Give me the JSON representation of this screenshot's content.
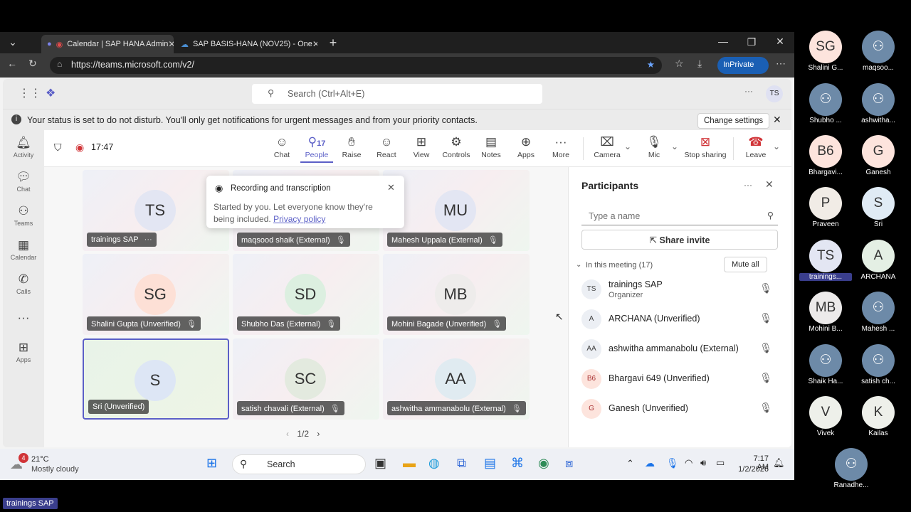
{
  "browser": {
    "tabs": [
      {
        "label": "Calendar | SAP HANA Admin"
      },
      {
        "label": "SAP BASIS-HANA (NOV25) - One"
      }
    ],
    "url": "https://teams.microsoft.com/v2/",
    "inprivate": "InPrivate"
  },
  "teams": {
    "search_placeholder": "Search (Ctrl+Alt+E)",
    "user_initials": "TS",
    "notice": "Your status is set to do not disturb. You'll only get notifications for urgent messages and from your priority contacts.",
    "change_settings": "Change settings",
    "rail": [
      {
        "label": "Activity",
        "icon": "bell-icon"
      },
      {
        "label": "Chat",
        "icon": "chat-icon"
      },
      {
        "label": "Teams",
        "icon": "teams-icon"
      },
      {
        "label": "Calendar",
        "icon": "calendar-icon"
      },
      {
        "label": "Calls",
        "icon": "phone-icon"
      },
      {
        "label": "Apps",
        "icon": "apps-icon"
      }
    ]
  },
  "meeting": {
    "timer": "17:47",
    "controls": {
      "chat": "Chat",
      "people": "People",
      "people_count": "17",
      "raise": "Raise",
      "react": "React",
      "view": "View",
      "controls": "Controls",
      "notes": "Notes",
      "apps": "Apps",
      "more": "More",
      "camera": "Camera",
      "mic": "Mic",
      "stop_sharing": "Stop sharing",
      "leave": "Leave"
    },
    "popup": {
      "title": "Recording and transcription",
      "body": "Started by you. Let everyone know they're being included.",
      "link": "Privacy policy"
    },
    "tiles": [
      {
        "initials": "TS",
        "name": "trainings SAP",
        "more": "···"
      },
      {
        "initials": "",
        "name": "maqsood shaik (External)"
      },
      {
        "initials": "MU",
        "name": "Mahesh Uppala (External)"
      },
      {
        "initials": "SG",
        "name": "Shalini Gupta (Unverified)"
      },
      {
        "initials": "SD",
        "name": "Shubho Das (External)"
      },
      {
        "initials": "MB",
        "name": "Mohini Bagade (Unverified)"
      },
      {
        "initials": "S",
        "name": "Sri (Unverified)"
      },
      {
        "initials": "SC",
        "name": "satish chavali (External)"
      },
      {
        "initials": "AA",
        "name": "ashwitha ammanabolu (External)"
      }
    ],
    "pagination": "1/2"
  },
  "participants": {
    "title": "Participants",
    "search_placeholder": "Type a name",
    "share_invite": "Share invite",
    "section": "In this meeting (17)",
    "mute_all": "Mute all",
    "list": [
      {
        "initials": "TS",
        "name": "trainings SAP",
        "role": "Organizer"
      },
      {
        "initials": "A",
        "name": "ARCHANA (Unverified)"
      },
      {
        "initials": "AA",
        "name": "ashwitha ammanabolu (External)"
      },
      {
        "initials": "B6",
        "name": "Bhargavi 649 (Unverified)"
      },
      {
        "initials": "G",
        "name": "Ganesh (Unverified)"
      }
    ]
  },
  "taskbar": {
    "weather_temp": "21°C",
    "weather_desc": "Mostly cloudy",
    "weather_badge": "4",
    "search": "Search",
    "time": "7:17 AM",
    "date": "1/2/2026"
  },
  "gallery": [
    {
      "initials": "SG",
      "name": "Shalini G..."
    },
    {
      "initials": "",
      "name": "maqsoo..."
    },
    {
      "initials": "",
      "name": "Shubho ..."
    },
    {
      "initials": "",
      "name": "ashwitha..."
    },
    {
      "initials": "B6",
      "name": "Bhargavi..."
    },
    {
      "initials": "G",
      "name": "Ganesh"
    },
    {
      "initials": "P",
      "name": "Praveen"
    },
    {
      "initials": "S",
      "name": "Sri"
    },
    {
      "initials": "TS",
      "name": "trainings..."
    },
    {
      "initials": "A",
      "name": "ARCHANA"
    },
    {
      "initials": "MB",
      "name": "Mohini B..."
    },
    {
      "initials": "",
      "name": "Mahesh ..."
    },
    {
      "initials": "",
      "name": "Shaik Ha..."
    },
    {
      "initials": "",
      "name": "satish ch..."
    },
    {
      "initials": "V",
      "name": "Vivek"
    },
    {
      "initials": "K",
      "name": "Kailas"
    },
    {
      "initials": "",
      "name": "Ranadhe..."
    }
  ],
  "presenter_badge": "trainings SAP"
}
